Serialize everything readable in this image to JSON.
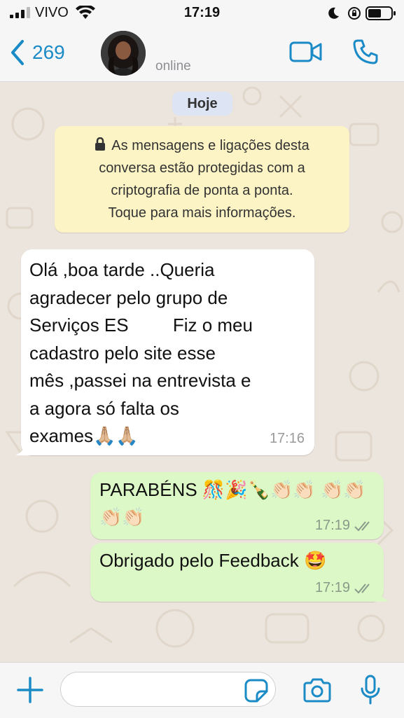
{
  "status_bar": {
    "carrier": "VIVO",
    "time": "17:19"
  },
  "header": {
    "back_count": "269",
    "contact_status": "online"
  },
  "chat": {
    "date_label": "Hoje",
    "encryption_notice": [
      "As mensagens e ligações desta",
      "conversa estão protegidas com a",
      "criptografia de ponta a ponta.",
      "Toque para mais informações."
    ],
    "messages": [
      {
        "direction": "incoming",
        "text_part1": "Olá ,boa tarde ..Queria\nagradecer pelo grupo de\nServiços ES",
        "text_part2": " Fiz o meu\ncadastro pelo site esse\nmês ,passei na entrevista e\na agora  só falta os\nexames🙏🏼🙏🏼",
        "time": "17:16"
      },
      {
        "direction": "outgoing",
        "text": "PARABÉNS 🎊🎉🍾👏🏻👏🏻 👏🏻👏🏻👏🏻👏🏻",
        "time": "17:19"
      },
      {
        "direction": "outgoing",
        "text": "Obrigado pelo Feedback 🤩",
        "time": "17:19"
      }
    ]
  },
  "input": {
    "placeholder": "",
    "value": ""
  },
  "colors": {
    "accent": "#1a8bc6",
    "outgoing_bubble": "#dcf8c6",
    "incoming_bubble": "#ffffff",
    "notice_bg": "#fcf4c4",
    "date_pill_bg": "#dde4f4",
    "chat_bg": "#ece5dd"
  },
  "icons": [
    "signal-icon",
    "wifi-icon",
    "moon-icon",
    "rotation-lock-icon",
    "battery-icon",
    "chevron-left-icon",
    "video-call-icon",
    "phone-icon",
    "lock-icon",
    "double-check-icon",
    "plus-icon",
    "sticker-icon",
    "camera-icon",
    "microphone-icon"
  ]
}
